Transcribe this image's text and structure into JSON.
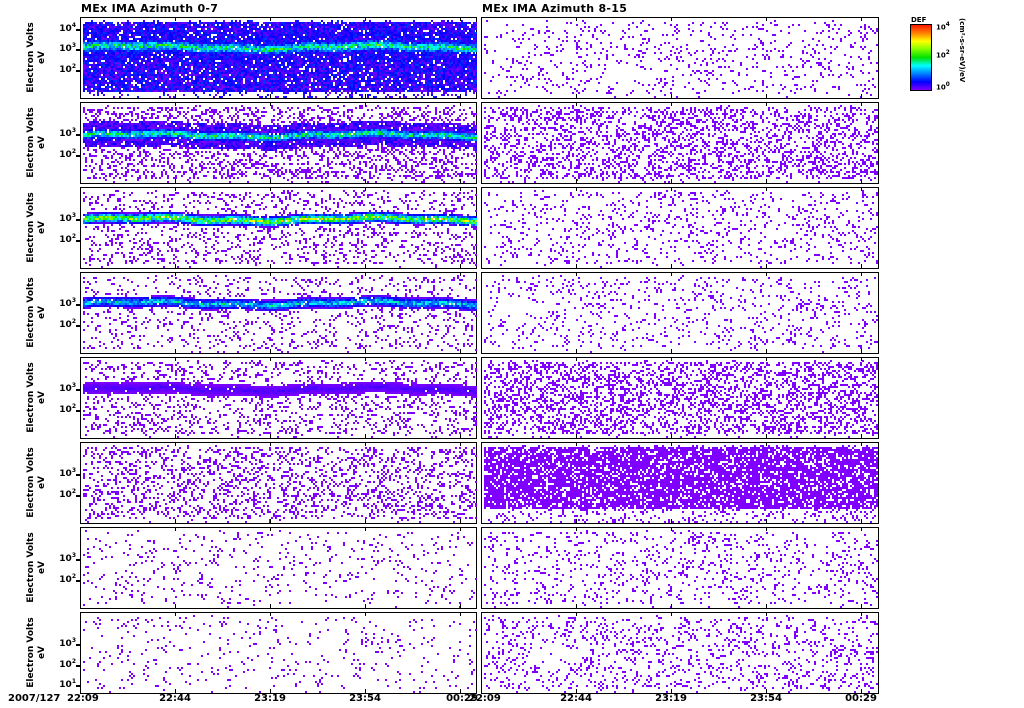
{
  "chart_data": {
    "type": "heatmap",
    "titles": [
      "MEx IMA Azimuth 0-7",
      "MEx IMA Azimuth 8-15"
    ],
    "ylabel": [
      "Electron Volts",
      "eV"
    ],
    "date_label": "2007/127",
    "xticks_left": [
      "22:09",
      "22:44",
      "23:19",
      "23:54",
      "00:29"
    ],
    "xticks_right": [
      "22:09",
      "22:44",
      "23:19",
      "23:54",
      "00:29"
    ],
    "yscale": "log",
    "ylim_log10": [
      0.6,
      4.6
    ],
    "yticks_default": [
      {
        "base": "10",
        "exp": "3",
        "log": 3
      },
      {
        "base": "10",
        "exp": "2",
        "log": 2
      }
    ],
    "yticks_first": [
      {
        "base": "10",
        "exp": "4",
        "log": 4
      },
      {
        "base": "10",
        "exp": "3",
        "log": 3
      },
      {
        "base": "10",
        "exp": "2",
        "log": 2
      }
    ],
    "yticks_last": [
      {
        "base": "10",
        "exp": "3",
        "log": 3
      },
      {
        "base": "10",
        "exp": "2",
        "log": 2
      },
      {
        "base": "10",
        "exp": "1",
        "log": 1
      }
    ],
    "colorbar": {
      "title": "DEF",
      "ticks": [
        {
          "base": "10",
          "exp": "4"
        },
        {
          "base": "10",
          "exp": "2"
        },
        {
          "base": "10",
          "exp": "0"
        }
      ],
      "units": "(cm²-s-sr-eV)/eV"
    },
    "panels_left": [
      {
        "row": 1,
        "background_fill": 0.92,
        "band_log_eV": 3.2,
        "band_intensity": 0.45
      },
      {
        "row": 2,
        "background_fill": 0.3,
        "band_log_eV": 3.05,
        "band_intensity": 0.45
      },
      {
        "row": 3,
        "background_fill": 0.18,
        "band_log_eV": 3.1,
        "band_intensity": 0.6
      },
      {
        "row": 4,
        "background_fill": 0.14,
        "band_log_eV": 3.15,
        "band_intensity": 0.35
      },
      {
        "row": 5,
        "background_fill": 0.2,
        "band_log_eV": 3.1,
        "band_intensity": 0.05
      },
      {
        "row": 6,
        "background_fill": 0.24,
        "band_log_eV": null,
        "band_intensity": 0
      },
      {
        "row": 7,
        "background_fill": 0.07,
        "band_log_eV": null,
        "band_intensity": 0
      },
      {
        "row": 8,
        "background_fill": 0.05,
        "band_log_eV": null,
        "band_intensity": 0
      }
    ],
    "panels_right": [
      {
        "row": 1,
        "background_fill": 0.1
      },
      {
        "row": 2,
        "background_fill": 0.3
      },
      {
        "row": 3,
        "background_fill": 0.12
      },
      {
        "row": 4,
        "background_fill": 0.1
      },
      {
        "row": 5,
        "background_fill": 0.35
      },
      {
        "row": 6,
        "background_fill": 0.78
      },
      {
        "row": 7,
        "background_fill": 0.12
      },
      {
        "row": 8,
        "background_fill": 0.15
      }
    ]
  }
}
